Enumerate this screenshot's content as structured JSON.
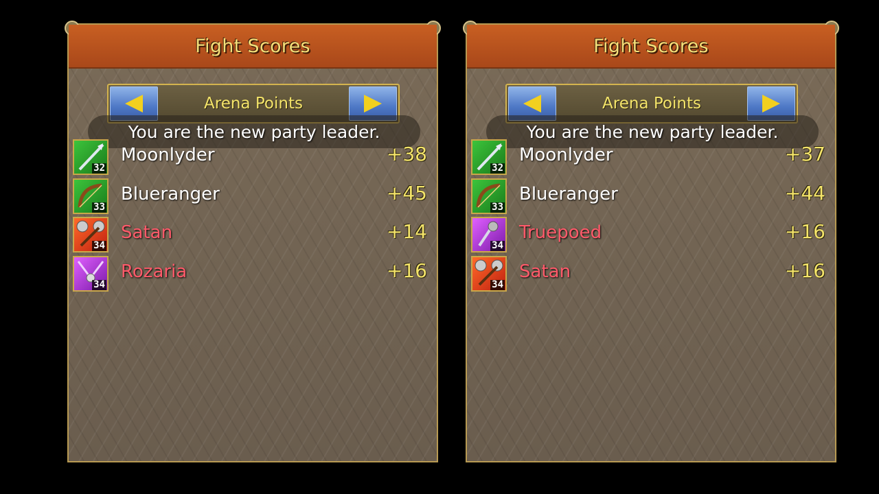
{
  "panels": [
    {
      "title": "Fight Scores",
      "selector_label": "Arena Points",
      "toast": "You are the new party leader.",
      "rows": [
        {
          "icon": "spear-class-icon",
          "level": "32",
          "name": "Moonlyder",
          "score": "+38",
          "name_color": "white"
        },
        {
          "icon": "bow-class-icon",
          "level": "33",
          "name": "Blueranger",
          "score": "+45",
          "name_color": "white"
        },
        {
          "icon": "mace-class-icon",
          "level": "34",
          "name": "Satan",
          "score": "+14",
          "name_color": "red"
        },
        {
          "icon": "staff-class-icon",
          "level": "34",
          "name": "Rozaria",
          "score": "+16",
          "name_color": "red"
        }
      ]
    },
    {
      "title": "Fight Scores",
      "selector_label": "Arena Points",
      "toast": "You are the new party leader.",
      "rows": [
        {
          "icon": "spear-class-icon",
          "level": "32",
          "name": "Moonlyder",
          "score": "+37",
          "name_color": "white"
        },
        {
          "icon": "bow-class-icon",
          "level": "33",
          "name": "Blueranger",
          "score": "+44",
          "name_color": "white"
        },
        {
          "icon": "staff-class-icon",
          "level": "34",
          "name": "Truepoed",
          "score": "+16",
          "name_color": "red"
        },
        {
          "icon": "mace-class-icon",
          "level": "34",
          "name": "Satan",
          "score": "+16",
          "name_color": "red"
        }
      ]
    }
  ],
  "colors": {
    "title_bar": "#b8521e",
    "title_text": "#f4e07a",
    "score_text": "#f4e46a",
    "enemy_name": "#ff5a6a",
    "ally_name": "#ffffff"
  }
}
